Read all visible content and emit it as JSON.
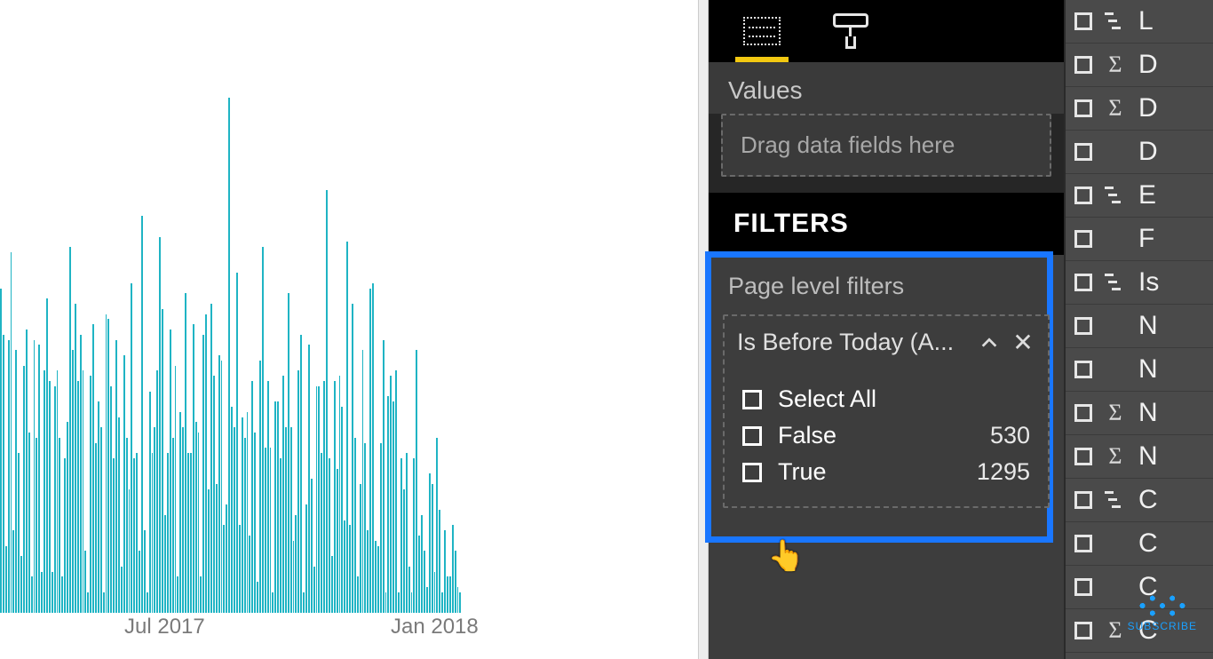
{
  "chart_data": {
    "type": "bar",
    "title": "",
    "xlabel": "",
    "ylabel": "",
    "ylim": [
      0,
      100
    ],
    "x_tick_labels": [
      "Jul 2017",
      "Jan 2018"
    ],
    "categories_count": 180,
    "values": [
      63,
      54,
      13,
      53,
      70,
      16,
      51,
      31,
      11,
      48,
      55,
      35,
      7,
      53,
      34,
      52,
      8,
      47,
      61,
      45,
      8,
      44,
      47,
      34,
      7,
      30,
      37,
      71,
      51,
      60,
      45,
      54,
      47,
      12,
      4,
      46,
      56,
      33,
      41,
      36,
      4,
      58,
      57,
      44,
      30,
      53,
      38,
      9,
      50,
      34,
      24,
      64,
      30,
      31,
      12,
      77,
      16,
      4,
      43,
      31,
      36,
      47,
      73,
      59,
      19,
      31,
      55,
      34,
      48,
      7,
      39,
      36,
      62,
      31,
      31,
      56,
      37,
      35,
      7,
      54,
      58,
      24,
      60,
      46,
      25,
      50,
      49,
      17,
      21,
      100,
      40,
      36,
      66,
      17,
      38,
      34,
      39,
      15,
      45,
      35,
      6,
      49,
      71,
      32,
      45,
      32,
      4,
      41,
      41,
      30,
      46,
      36,
      62,
      36,
      14,
      19,
      47,
      54,
      4,
      21,
      52,
      26,
      9,
      44,
      44,
      31,
      45,
      82,
      30,
      11,
      45,
      28,
      46,
      40,
      18,
      72,
      17,
      60,
      34,
      7,
      25,
      51,
      33,
      16,
      63,
      64,
      14,
      13,
      33,
      53,
      4,
      42,
      46,
      41,
      47,
      4,
      30,
      24,
      31,
      9,
      4,
      30,
      51,
      15,
      19,
      12,
      5,
      27,
      25,
      8,
      34,
      20,
      4,
      16,
      7,
      7,
      17,
      12,
      5,
      4
    ]
  },
  "viz_panel": {
    "values_label": "Values",
    "drop_placeholder": "Drag data fields here",
    "filters_header": "FILTERS",
    "page_filters_label": "Page level filters",
    "filter_card": {
      "title": "Is Before Today (A...",
      "options": [
        {
          "label": "Select All",
          "count": ""
        },
        {
          "label": "False",
          "count": "530"
        },
        {
          "label": "True",
          "count": "1295"
        }
      ]
    }
  },
  "fields_panel": {
    "items": [
      {
        "icon": "hier",
        "label": "L"
      },
      {
        "icon": "sigma",
        "label": "D"
      },
      {
        "icon": "sigma",
        "label": "D"
      },
      {
        "icon": "",
        "label": "D"
      },
      {
        "icon": "hier",
        "label": "E"
      },
      {
        "icon": "",
        "label": "F"
      },
      {
        "icon": "hier",
        "label": "Is"
      },
      {
        "icon": "",
        "label": "N"
      },
      {
        "icon": "",
        "label": "N"
      },
      {
        "icon": "sigma",
        "label": "N"
      },
      {
        "icon": "sigma",
        "label": "N"
      },
      {
        "icon": "hier",
        "label": "C"
      },
      {
        "icon": "",
        "label": "C"
      },
      {
        "icon": "",
        "label": "C"
      },
      {
        "icon": "sigma",
        "label": "C"
      }
    ]
  },
  "watermark": "SUBSCRIBE"
}
